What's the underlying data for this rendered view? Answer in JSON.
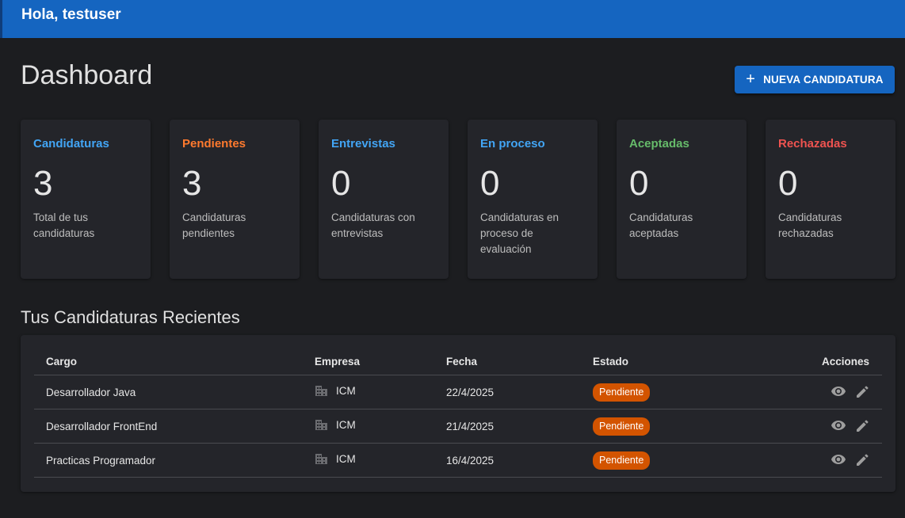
{
  "header": {
    "greeting": "Hola, testuser"
  },
  "page": {
    "title": "Dashboard",
    "new_button_label": "NUEVA CANDIDATURA"
  },
  "stats": [
    {
      "title": "Candidaturas",
      "count": "3",
      "desc": "Total de tus candidaturas",
      "color": "#42a5f5"
    },
    {
      "title": "Pendientes",
      "count": "3",
      "desc": "Candidaturas pendientes",
      "color": "#ff7a2e"
    },
    {
      "title": "Entrevistas",
      "count": "0",
      "desc": "Candidaturas con entrevistas",
      "color": "#42a5f5"
    },
    {
      "title": "En proceso",
      "count": "0",
      "desc": "Candidaturas en proceso de evaluación",
      "color": "#42a5f5"
    },
    {
      "title": "Aceptadas",
      "count": "0",
      "desc": "Candidaturas aceptadas",
      "color": "#66bb6a"
    },
    {
      "title": "Rechazadas",
      "count": "0",
      "desc": "Candidaturas rechazadas",
      "color": "#ef5350"
    }
  ],
  "recent": {
    "title": "Tus Candidaturas Recientes",
    "columns": [
      "Cargo",
      "Empresa",
      "Fecha",
      "Estado",
      "Acciones"
    ],
    "rows": [
      {
        "cargo": "Desarrollador Java",
        "empresa": "ICM",
        "fecha": "22/4/2025",
        "estado": "Pendiente"
      },
      {
        "cargo": "Desarrollador FrontEnd",
        "empresa": "ICM",
        "fecha": "21/4/2025",
        "estado": "Pendiente"
      },
      {
        "cargo": "Practicas Programador",
        "empresa": "ICM",
        "fecha": "16/4/2025",
        "estado": "Pendiente"
      }
    ]
  },
  "icons": {
    "add": "plus-icon",
    "company": "building-icon",
    "view": "eye-icon",
    "edit": "pencil-icon"
  },
  "colors": {
    "primary": "#1565c0",
    "status_pending": "#d35400"
  }
}
